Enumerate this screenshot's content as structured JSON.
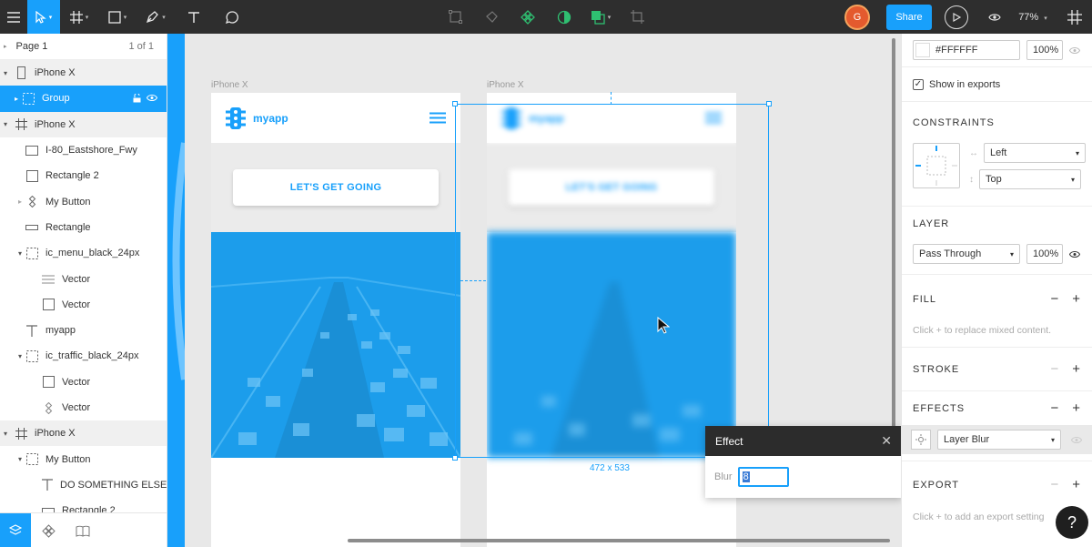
{
  "toolbar": {
    "zoom": "77%",
    "share_label": "Share",
    "avatar_initial": "G",
    "accent": "#18a0fb"
  },
  "left_panel": {
    "page_label": "Page 1",
    "page_count": "1 of 1",
    "layers": [
      {
        "label": "iPhone X",
        "icon": "phone-frame-icon"
      },
      {
        "label": "Group",
        "icon": "group-icon"
      },
      {
        "label": "iPhone X",
        "icon": "frame-icon"
      },
      {
        "label": "I-80_Eastshore_Fwy",
        "icon": "image-icon"
      },
      {
        "label": "Rectangle 2",
        "icon": "rectangle-icon"
      },
      {
        "label": "My Button",
        "icon": "component-icon"
      },
      {
        "label": "Rectangle",
        "icon": "rectangle-icon"
      },
      {
        "label": "ic_menu_black_24px",
        "icon": "group-icon"
      },
      {
        "label": "Vector",
        "icon": "vector-icon"
      },
      {
        "label": "Vector",
        "icon": "vector-icon"
      },
      {
        "label": "myapp",
        "icon": "text-icon"
      },
      {
        "label": "ic_traffic_black_24px",
        "icon": "group-icon"
      },
      {
        "label": "Vector",
        "icon": "vector-icon"
      },
      {
        "label": "Vector",
        "icon": "vector-icon"
      },
      {
        "label": "iPhone X",
        "icon": "frame-icon"
      },
      {
        "label": "My Button",
        "icon": "group-icon"
      },
      {
        "label": "DO SOMETHING ELSE",
        "icon": "text-icon"
      },
      {
        "label": "Rectangle 2",
        "icon": "rectangle-icon"
      }
    ]
  },
  "canvas": {
    "frame1_label": "iPhone X",
    "frame2_label": "iPhone X",
    "app_name": "myapp",
    "cta_label": "LET'S GET GOING",
    "selection_size": "472 x 533"
  },
  "effect_popup": {
    "title": "Effect",
    "blur_label": "Blur",
    "blur_value": "8"
  },
  "right_panel": {
    "export_color": "#FFFFFF",
    "export_opacity": "100%",
    "show_in_exports": "Show in exports",
    "constraints_title": "CONSTRAINTS",
    "constraint_h": "Left",
    "constraint_v": "Top",
    "layer_title": "LAYER",
    "blend_mode": "Pass Through",
    "layer_opacity": "100%",
    "fill_title": "FILL",
    "fill_hint": "Click + to replace mixed content.",
    "stroke_title": "STROKE",
    "effects_title": "EFFECTS",
    "effect_type": "Layer Blur",
    "export_title": "EXPORT",
    "export_hint": "Click + to add an export setting"
  },
  "help_label": "?"
}
